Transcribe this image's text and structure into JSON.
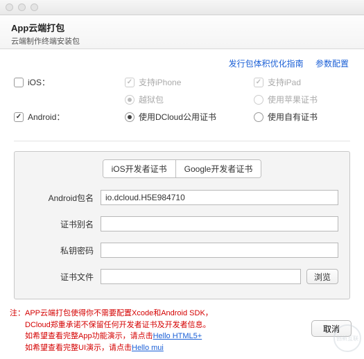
{
  "header": {
    "title": "App云端打包",
    "subtitle": "云端制作终端安装包"
  },
  "links": {
    "guide": "发行包体积优化指南",
    "params": "参数配置"
  },
  "platforms": {
    "ios": {
      "label": "iOS：",
      "opt_iphone": "支持iPhone",
      "opt_ipad": "支持iPad",
      "opt_jailbreak": "越狱包",
      "opt_apple_cert": "使用苹果证书"
    },
    "android": {
      "label": "Android：",
      "opt_dcloud_cert": "使用DCloud公用证书",
      "opt_own_cert": "使用自有证书"
    }
  },
  "tabs": {
    "ios_cert": "iOS开发者证书",
    "google_cert": "Google开发者证书"
  },
  "fields": {
    "package_label": "Android包名",
    "package_value": "io.dcloud.H5E984710",
    "alias_label": "证书别名",
    "alias_value": "",
    "keypass_label": "私钥密码",
    "keypass_value": "",
    "certfile_label": "证书文件",
    "certfile_value": "",
    "browse": "浏览"
  },
  "footer": {
    "note_prefix": "注：",
    "line1": "APP云端打包使得你不需要配置Xcode和Android SDK，",
    "line2": "DCloud郑重承诺不保留任何开发者证书及开发者信息。",
    "line3a": "如希望查看完整App功能演示，请点击",
    "link1": "Hello HTML5+",
    "line4a": "如希望查看完整UI演示，请点击",
    "link2": "Hello mui",
    "cancel": "取消"
  },
  "watermark": "创新互联"
}
